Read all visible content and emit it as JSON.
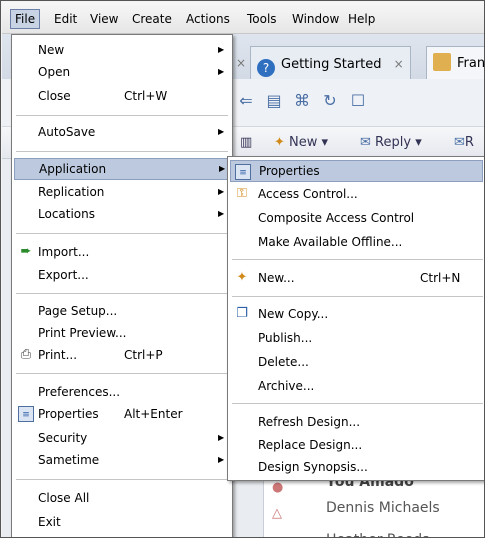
{
  "menubar": {
    "items": [
      "File",
      "Edit",
      "View",
      "Create",
      "Actions",
      "Tools",
      "Window",
      "Help"
    ]
  },
  "background": {
    "tabs": [
      {
        "label": "Getting Started",
        "close": "×"
      },
      {
        "label": "Fran"
      }
    ],
    "orphan_close": "×",
    "actionbar": [
      "New",
      "Reply",
      "R"
    ],
    "list_rows": [
      "You Amado",
      "Dennis Michaels",
      "Heather Reeds"
    ]
  },
  "file_menu": {
    "items": [
      {
        "label": "New",
        "submenu": true
      },
      {
        "label": "Open",
        "submenu": true
      },
      {
        "label": "Close",
        "shortcut": "Ctrl+W"
      },
      {
        "label": "AutoSave",
        "submenu": true
      },
      {
        "label": "Application",
        "submenu": true,
        "highlighted": true
      },
      {
        "label": "Replication",
        "submenu": true
      },
      {
        "label": "Locations",
        "submenu": true
      },
      {
        "label": "Import...",
        "icon": "import-icon"
      },
      {
        "label": "Export..."
      },
      {
        "label": "Page Setup..."
      },
      {
        "label": "Print Preview..."
      },
      {
        "label": "Print...",
        "shortcut": "Ctrl+P",
        "icon": "printer-icon"
      },
      {
        "label": "Preferences..."
      },
      {
        "label": "Properties",
        "shortcut": "Alt+Enter",
        "icon": "properties-icon"
      },
      {
        "label": "Security",
        "submenu": true
      },
      {
        "label": "Sametime",
        "submenu": true
      },
      {
        "label": "Close All"
      },
      {
        "label": "Exit"
      }
    ]
  },
  "application_menu": {
    "items": [
      {
        "label": "Properties",
        "icon": "properties-icon",
        "highlighted": true
      },
      {
        "label": "Access Control...",
        "icon": "access-control-icon"
      },
      {
        "label": "Composite Access Control"
      },
      {
        "label": "Make Available Offline..."
      },
      {
        "label": "New...",
        "shortcut": "Ctrl+N",
        "icon": "new-app-icon"
      },
      {
        "label": "New Copy...",
        "icon": "new-copy-icon"
      },
      {
        "label": "Publish..."
      },
      {
        "label": "Delete..."
      },
      {
        "label": "Archive..."
      },
      {
        "label": "Refresh Design..."
      },
      {
        "label": "Replace Design..."
      },
      {
        "label": "Design Synopsis..."
      }
    ]
  },
  "colors": {
    "highlight": "#bcc9de",
    "menubar_active": "#c8d3e4"
  }
}
